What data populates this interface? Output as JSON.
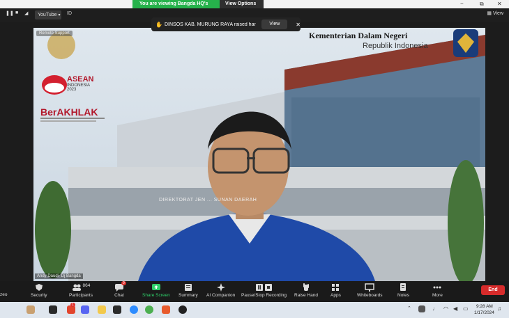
{
  "topbar": {
    "share_text": "You are viewing Bangda HQ's screen",
    "view_options": "View Options",
    "win_min": "−",
    "win_restore": "⧉",
    "win_close": "✕"
  },
  "strip": {
    "youtube_label": "YouTube",
    "id_label": "ID",
    "view_label": "View"
  },
  "notification": {
    "text": "DINSOS KAB. MURUNG RAYA raised hand",
    "view_label": "View"
  },
  "video": {
    "overlay_title": "Kementerian Dalam Negeri",
    "overlay_subtitle": "Republik Indonesia",
    "asean_line1": "ASEAN",
    "asean_line2": "INDONESIA",
    "asean_line3": "2023",
    "berakhlak": "BerAKHLAK",
    "record_badge": "Remote Support",
    "speaker_name": "Andy Daudi- Dj Bangda",
    "building_sign": "DIREKTORAT JEN ... SUNAN DAERAH"
  },
  "toolbar": {
    "items": [
      {
        "label": "zeo"
      },
      {
        "label": "Security"
      },
      {
        "label": "Participants",
        "count": "864"
      },
      {
        "label": "Chat",
        "badge": "9"
      },
      {
        "label": "Share Screen"
      },
      {
        "label": "Summary"
      },
      {
        "label": "AI Companion"
      },
      {
        "label": "Pause/Stop Recording"
      },
      {
        "label": "Raise Hand"
      },
      {
        "label": "Apps"
      },
      {
        "label": "Whiteboards"
      },
      {
        "label": "Notes"
      },
      {
        "label": "More"
      }
    ],
    "end_label": "End"
  },
  "taskbar": {
    "time": "9:28 AM",
    "date": "1/17/2024",
    "notification_count": "1"
  },
  "colors": {
    "share_green": "#26b24b",
    "end_red": "#d62b2b",
    "share_screen_green": "#2fd06a"
  }
}
